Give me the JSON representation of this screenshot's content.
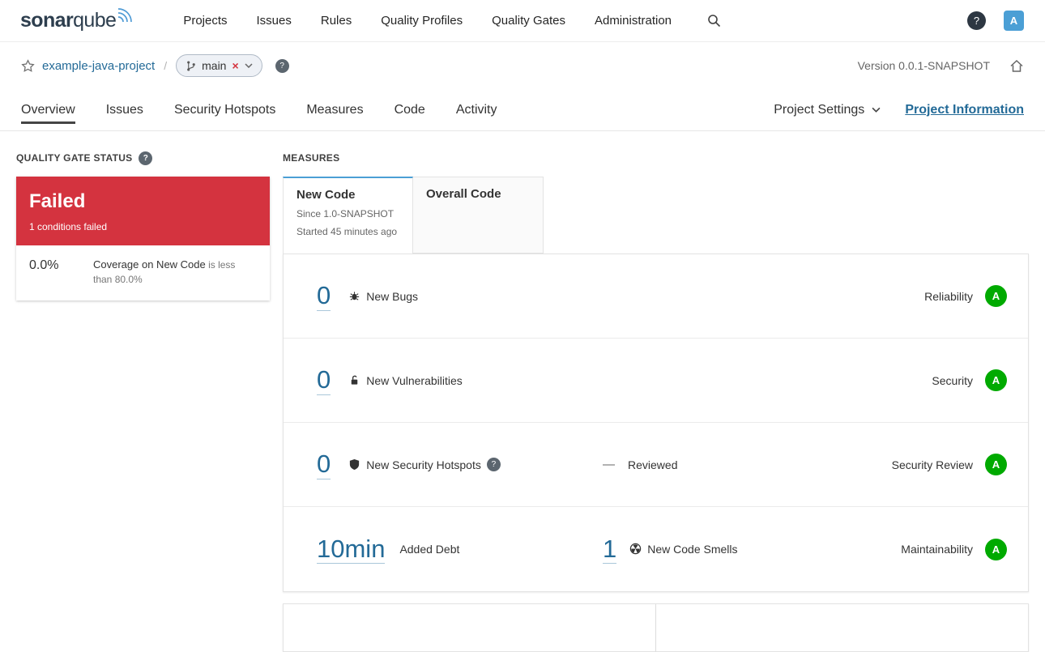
{
  "navbar": {
    "logo_part1": "sonar",
    "logo_part2": "qube",
    "items": [
      "Projects",
      "Issues",
      "Rules",
      "Quality Profiles",
      "Quality Gates",
      "Administration"
    ],
    "avatar": "A"
  },
  "icons": {
    "help_glyph": "?",
    "branch_failed_glyph": "×"
  },
  "breadcrumb": {
    "project": "example-java-project",
    "separator": "/",
    "branch": "main",
    "version": "Version 0.0.1-SNAPSHOT"
  },
  "tabs": {
    "items": [
      "Overview",
      "Issues",
      "Security Hotspots",
      "Measures",
      "Code",
      "Activity"
    ],
    "project_settings": "Project Settings",
    "project_information": "Project Information"
  },
  "quality_gate": {
    "title": "QUALITY GATE STATUS",
    "status": "Failed",
    "conditions_summary": "1 conditions failed",
    "condition": {
      "value": "0.0%",
      "metric": "Coverage on New Code",
      "requirement": "is less than 80.0%"
    }
  },
  "measures": {
    "title": "MEASURES",
    "new_code_tab": {
      "label": "New Code",
      "since": "Since 1.0-SNAPSHOT",
      "started": "Started 45 minutes ago"
    },
    "overall_tab": {
      "label": "Overall Code"
    },
    "rows": [
      {
        "value": "0",
        "label": "New Bugs",
        "domain": "Reliability",
        "rating": "A"
      },
      {
        "value": "0",
        "label": "New Vulnerabilities",
        "domain": "Security",
        "rating": "A"
      },
      {
        "value": "0",
        "label": "New Security Hotspots",
        "reviewed_value": "—",
        "reviewed_label": "Reviewed",
        "domain": "Security Review",
        "rating": "A"
      },
      {
        "value": "10min",
        "label": "Added Debt",
        "smells_value": "1",
        "smells_label": "New Code Smells",
        "domain": "Maintainability",
        "rating": "A"
      }
    ]
  },
  "colors": {
    "failed_red": "#d4333f",
    "rating_a_green": "#00aa00",
    "link_blue": "#236a97",
    "tab_accent_blue": "#4b9fd5"
  }
}
